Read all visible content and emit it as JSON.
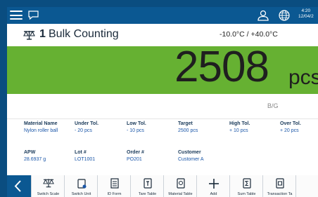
{
  "header": {
    "clock_time": "4:20",
    "clock_date": "12/04/2"
  },
  "title": {
    "scale_number": "1",
    "app_name": "Bulk Counting",
    "temperature_range": "-10.0°C / +40.0°C"
  },
  "display": {
    "weight_value": "2508",
    "unit": "pcs",
    "mode": "B/G"
  },
  "info": {
    "material_name": {
      "label": "Material Name",
      "value": "Nylon roller ball"
    },
    "under_tol": {
      "label": "Under Tol.",
      "value": "- 20 pcs"
    },
    "low_tol": {
      "label": "Low Tol.",
      "value": "- 10 pcs"
    },
    "target": {
      "label": "Target",
      "value": "2500 pcs"
    },
    "high_tol": {
      "label": "High Tol.",
      "value": "+ 10 pcs"
    },
    "over_tol": {
      "label": "Over Tol.",
      "value": "+ 20 pcs"
    },
    "apw": {
      "label": "APW",
      "value": "28.6937 g"
    },
    "lot": {
      "label": "Lot #",
      "value": "LOT1001"
    },
    "order": {
      "label": "Order #",
      "value": "PO201"
    },
    "customer": {
      "label": "Customer",
      "value": "Customer A"
    }
  },
  "softkeys": [
    {
      "label": "Switch Scale",
      "icon": "scale-icon"
    },
    {
      "label": "Switch Unit",
      "icon": "weight-icon"
    },
    {
      "label": "ID Form",
      "icon": "document-icon"
    },
    {
      "label": "Tare Table",
      "icon": "tare-icon"
    },
    {
      "label": "Material Table",
      "icon": "material-icon"
    },
    {
      "label": "Add",
      "icon": "plus-icon"
    },
    {
      "label": "Sum Table",
      "icon": "sum-icon"
    },
    {
      "label": "Transaction Ta",
      "icon": "transaction-icon"
    }
  ],
  "colors": {
    "frame": "#0a4d80",
    "topbar": "#0b5892",
    "display_green": "#66b132",
    "label_dark": "#1a3a5a",
    "value_blue": "#1a56a8"
  }
}
